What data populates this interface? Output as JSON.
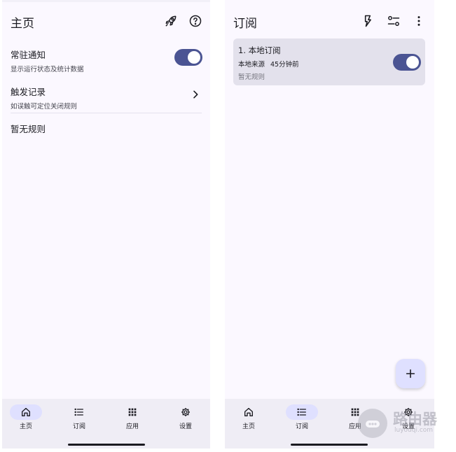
{
  "home": {
    "title": "主页",
    "icons": [
      "rocket-icon",
      "help-icon"
    ],
    "persistent_notice": {
      "title": "常驻通知",
      "subtitle": "显示运行状态及统计数据",
      "enabled": true
    },
    "trigger_log": {
      "title": "触发记录",
      "subtitle": "如误触可定位关闭规则"
    },
    "empty_text": "暂无规则"
  },
  "subscription": {
    "title": "订阅",
    "icons": [
      "flash-icon",
      "filter-icon",
      "more-vert-icon"
    ],
    "card": {
      "title": "1. 本地订阅",
      "source": "本地来源",
      "time": "45分钟前",
      "note": "暂无规则",
      "enabled": true
    },
    "fab_icon": "add-icon"
  },
  "nav": {
    "home": "主页",
    "subscription": "订阅",
    "apps": "应用",
    "settings": "设置",
    "left_active": "home",
    "right_active": "subscription"
  },
  "watermark": {
    "title": "路由器",
    "url": "luyouqi.com"
  },
  "colors": {
    "accent": "#4b5493",
    "pill": "#dfe0ff",
    "card": "#e3e1ec",
    "background": "#fbf8ff",
    "nav": "#efedf5"
  }
}
